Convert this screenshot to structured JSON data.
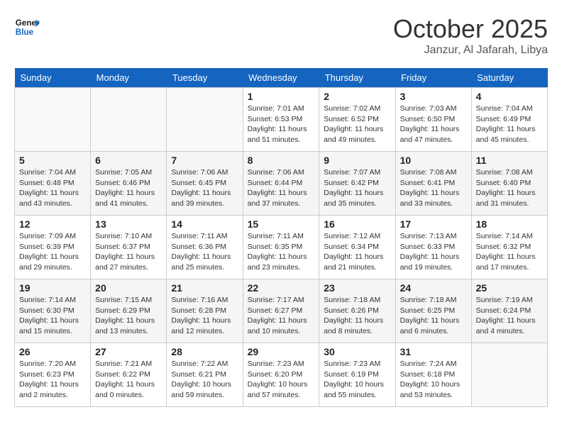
{
  "logo": {
    "line1": "General",
    "line2": "Blue"
  },
  "title": "October 2025",
  "location": "Janzur, Al Jafarah, Libya",
  "weekdays": [
    "Sunday",
    "Monday",
    "Tuesday",
    "Wednesday",
    "Thursday",
    "Friday",
    "Saturday"
  ],
  "weeks": [
    [
      {
        "day": "",
        "sunrise": "",
        "sunset": "",
        "daylight": ""
      },
      {
        "day": "",
        "sunrise": "",
        "sunset": "",
        "daylight": ""
      },
      {
        "day": "",
        "sunrise": "",
        "sunset": "",
        "daylight": ""
      },
      {
        "day": "1",
        "sunrise": "Sunrise: 7:01 AM",
        "sunset": "Sunset: 6:53 PM",
        "daylight": "Daylight: 11 hours and 51 minutes."
      },
      {
        "day": "2",
        "sunrise": "Sunrise: 7:02 AM",
        "sunset": "Sunset: 6:52 PM",
        "daylight": "Daylight: 11 hours and 49 minutes."
      },
      {
        "day": "3",
        "sunrise": "Sunrise: 7:03 AM",
        "sunset": "Sunset: 6:50 PM",
        "daylight": "Daylight: 11 hours and 47 minutes."
      },
      {
        "day": "4",
        "sunrise": "Sunrise: 7:04 AM",
        "sunset": "Sunset: 6:49 PM",
        "daylight": "Daylight: 11 hours and 45 minutes."
      }
    ],
    [
      {
        "day": "5",
        "sunrise": "Sunrise: 7:04 AM",
        "sunset": "Sunset: 6:48 PM",
        "daylight": "Daylight: 11 hours and 43 minutes."
      },
      {
        "day": "6",
        "sunrise": "Sunrise: 7:05 AM",
        "sunset": "Sunset: 6:46 PM",
        "daylight": "Daylight: 11 hours and 41 minutes."
      },
      {
        "day": "7",
        "sunrise": "Sunrise: 7:06 AM",
        "sunset": "Sunset: 6:45 PM",
        "daylight": "Daylight: 11 hours and 39 minutes."
      },
      {
        "day": "8",
        "sunrise": "Sunrise: 7:06 AM",
        "sunset": "Sunset: 6:44 PM",
        "daylight": "Daylight: 11 hours and 37 minutes."
      },
      {
        "day": "9",
        "sunrise": "Sunrise: 7:07 AM",
        "sunset": "Sunset: 6:42 PM",
        "daylight": "Daylight: 11 hours and 35 minutes."
      },
      {
        "day": "10",
        "sunrise": "Sunrise: 7:08 AM",
        "sunset": "Sunset: 6:41 PM",
        "daylight": "Daylight: 11 hours and 33 minutes."
      },
      {
        "day": "11",
        "sunrise": "Sunrise: 7:08 AM",
        "sunset": "Sunset: 6:40 PM",
        "daylight": "Daylight: 11 hours and 31 minutes."
      }
    ],
    [
      {
        "day": "12",
        "sunrise": "Sunrise: 7:09 AM",
        "sunset": "Sunset: 6:39 PM",
        "daylight": "Daylight: 11 hours and 29 minutes."
      },
      {
        "day": "13",
        "sunrise": "Sunrise: 7:10 AM",
        "sunset": "Sunset: 6:37 PM",
        "daylight": "Daylight: 11 hours and 27 minutes."
      },
      {
        "day": "14",
        "sunrise": "Sunrise: 7:11 AM",
        "sunset": "Sunset: 6:36 PM",
        "daylight": "Daylight: 11 hours and 25 minutes."
      },
      {
        "day": "15",
        "sunrise": "Sunrise: 7:11 AM",
        "sunset": "Sunset: 6:35 PM",
        "daylight": "Daylight: 11 hours and 23 minutes."
      },
      {
        "day": "16",
        "sunrise": "Sunrise: 7:12 AM",
        "sunset": "Sunset: 6:34 PM",
        "daylight": "Daylight: 11 hours and 21 minutes."
      },
      {
        "day": "17",
        "sunrise": "Sunrise: 7:13 AM",
        "sunset": "Sunset: 6:33 PM",
        "daylight": "Daylight: 11 hours and 19 minutes."
      },
      {
        "day": "18",
        "sunrise": "Sunrise: 7:14 AM",
        "sunset": "Sunset: 6:32 PM",
        "daylight": "Daylight: 11 hours and 17 minutes."
      }
    ],
    [
      {
        "day": "19",
        "sunrise": "Sunrise: 7:14 AM",
        "sunset": "Sunset: 6:30 PM",
        "daylight": "Daylight: 11 hours and 15 minutes."
      },
      {
        "day": "20",
        "sunrise": "Sunrise: 7:15 AM",
        "sunset": "Sunset: 6:29 PM",
        "daylight": "Daylight: 11 hours and 13 minutes."
      },
      {
        "day": "21",
        "sunrise": "Sunrise: 7:16 AM",
        "sunset": "Sunset: 6:28 PM",
        "daylight": "Daylight: 11 hours and 12 minutes."
      },
      {
        "day": "22",
        "sunrise": "Sunrise: 7:17 AM",
        "sunset": "Sunset: 6:27 PM",
        "daylight": "Daylight: 11 hours and 10 minutes."
      },
      {
        "day": "23",
        "sunrise": "Sunrise: 7:18 AM",
        "sunset": "Sunset: 6:26 PM",
        "daylight": "Daylight: 11 hours and 8 minutes."
      },
      {
        "day": "24",
        "sunrise": "Sunrise: 7:18 AM",
        "sunset": "Sunset: 6:25 PM",
        "daylight": "Daylight: 11 hours and 6 minutes."
      },
      {
        "day": "25",
        "sunrise": "Sunrise: 7:19 AM",
        "sunset": "Sunset: 6:24 PM",
        "daylight": "Daylight: 11 hours and 4 minutes."
      }
    ],
    [
      {
        "day": "26",
        "sunrise": "Sunrise: 7:20 AM",
        "sunset": "Sunset: 6:23 PM",
        "daylight": "Daylight: 11 hours and 2 minutes."
      },
      {
        "day": "27",
        "sunrise": "Sunrise: 7:21 AM",
        "sunset": "Sunset: 6:22 PM",
        "daylight": "Daylight: 11 hours and 0 minutes."
      },
      {
        "day": "28",
        "sunrise": "Sunrise: 7:22 AM",
        "sunset": "Sunset: 6:21 PM",
        "daylight": "Daylight: 10 hours and 59 minutes."
      },
      {
        "day": "29",
        "sunrise": "Sunrise: 7:23 AM",
        "sunset": "Sunset: 6:20 PM",
        "daylight": "Daylight: 10 hours and 57 minutes."
      },
      {
        "day": "30",
        "sunrise": "Sunrise: 7:23 AM",
        "sunset": "Sunset: 6:19 PM",
        "daylight": "Daylight: 10 hours and 55 minutes."
      },
      {
        "day": "31",
        "sunrise": "Sunrise: 7:24 AM",
        "sunset": "Sunset: 6:18 PM",
        "daylight": "Daylight: 10 hours and 53 minutes."
      },
      {
        "day": "",
        "sunrise": "",
        "sunset": "",
        "daylight": ""
      }
    ]
  ]
}
